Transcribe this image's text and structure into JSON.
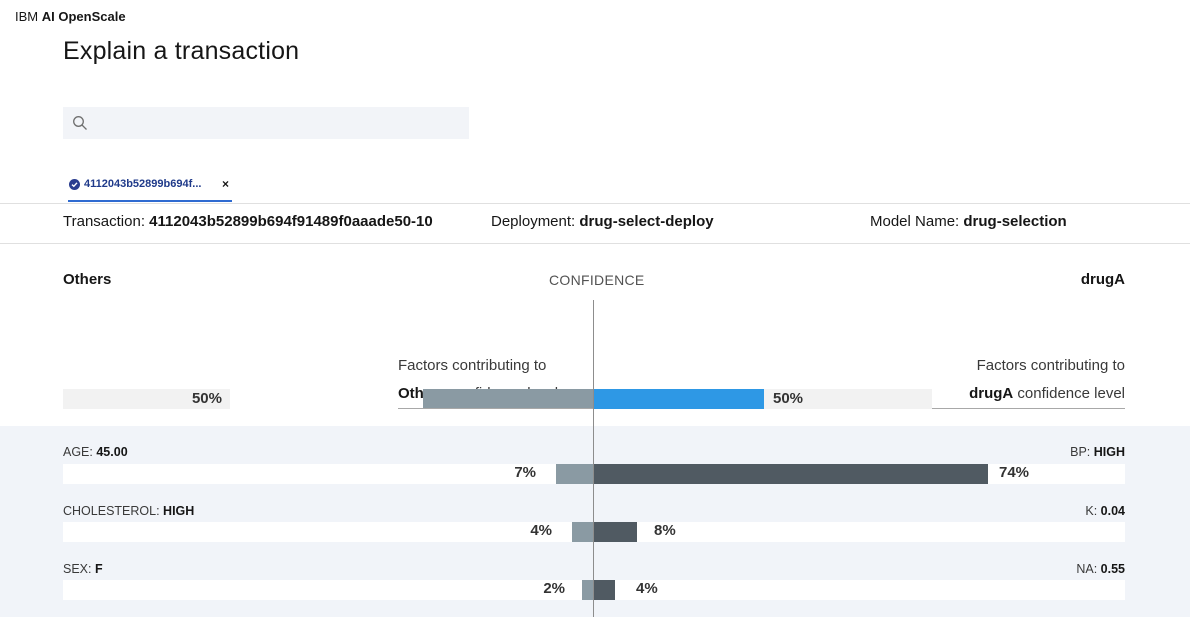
{
  "header": {
    "brand_prefix": "IBM",
    "brand_name": "AI OpenScale"
  },
  "page": {
    "title": "Explain a transaction"
  },
  "search": {
    "placeholder": "",
    "value": ""
  },
  "tab": {
    "label": "4112043b52899b694f...",
    "close": "×"
  },
  "transaction_info": {
    "transaction_label": "Transaction:",
    "transaction_value": "4112043b52899b694f91489f0aaade50-10",
    "deployment_label": "Deployment:",
    "deployment_value": "drug-select-deploy",
    "model_label": "Model Name:",
    "model_value": "drug-selection"
  },
  "confidence": {
    "heading": "CONFIDENCE",
    "left_class": "Others",
    "right_class": "drugA",
    "left_factors_line1": "Factors contributing to",
    "left_factors_class": "Others",
    "left_factors_suffix": " confidence level",
    "right_factors_line1": "Factors contributing to",
    "right_factors_class": "drugA",
    "right_factors_suffix": " confidence level",
    "left_value": 50,
    "left_pct": "50%",
    "right_value": 50,
    "right_pct": "50%"
  },
  "features": [
    {
      "left_name": "AGE:",
      "left_value": "45.00",
      "right_name": "BP:",
      "right_value": "HIGH",
      "left_pct": "7%",
      "left_amount": 7,
      "right_pct": "74%",
      "right_amount": 74
    },
    {
      "left_name": "CHOLESTEROL:",
      "left_value": "HIGH",
      "right_name": "K:",
      "right_value": "0.04",
      "left_pct": "4%",
      "left_amount": 4,
      "right_pct": "8%",
      "right_amount": 8
    },
    {
      "left_name": "SEX:",
      "left_value": "F",
      "right_name": "NA:",
      "right_value": "0.55",
      "left_pct": "2%",
      "left_amount": 2,
      "right_pct": "4%",
      "right_amount": 4
    }
  ],
  "colors": {
    "others_bar": "#8a9aa3",
    "drug_bar": "#2e98e5",
    "feature_right_bar": "#505a62",
    "tab_accent": "#2f6bd1"
  }
}
